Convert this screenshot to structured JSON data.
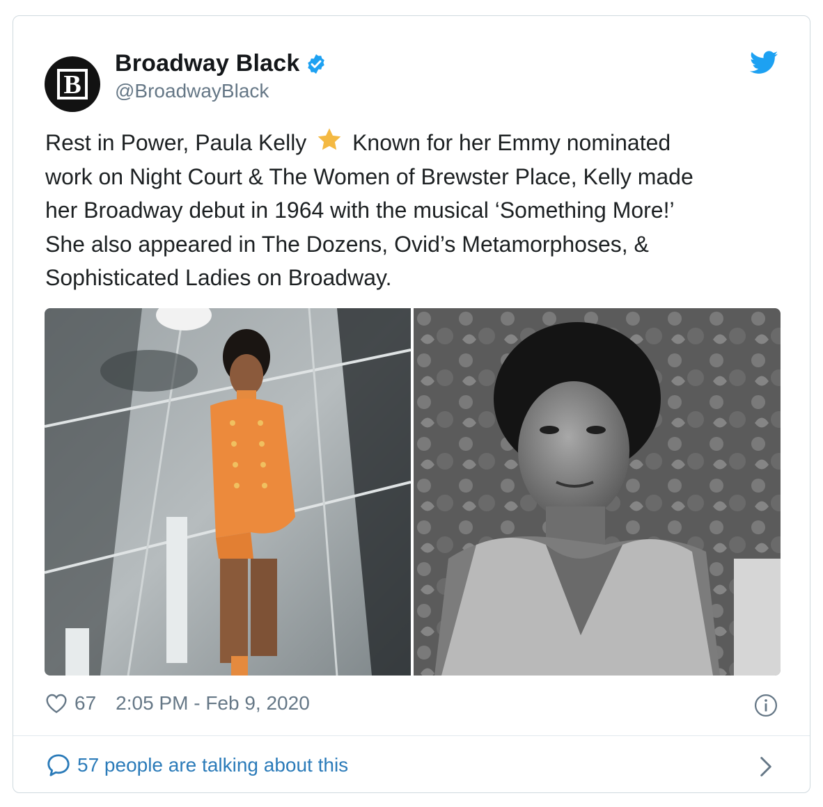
{
  "account": {
    "display_name": "Broadway Black",
    "handle": "@BroadwayBlack",
    "avatar_letter": "B",
    "verified": true
  },
  "tweet": {
    "text_before_emoji": "Rest in Power, Paula Kelly",
    "emoji": "star",
    "text_after_emoji": " Known for her Emmy nominated\nwork on Night Court & The Women of Brewster Place, Kelly made\nher Broadway debut in 1964 with the musical ‘Something More!’\nShe also appeared in The Dozens, Ovid’s Metamorphoses, &\nSophisticated Ladies on Broadway."
  },
  "media": {
    "photos": [
      "color-stage-photo",
      "black-and-white-portrait"
    ]
  },
  "meta": {
    "likes": "67",
    "timestamp": "2:05 PM - Feb 9, 2020"
  },
  "footer": {
    "talking_text": "57 people are talking about this"
  },
  "colors": {
    "twitter_blue": "#1da1f2",
    "link_blue": "#2b7bb9",
    "muted_gray": "#657786",
    "star_gold": "#f4b942"
  }
}
